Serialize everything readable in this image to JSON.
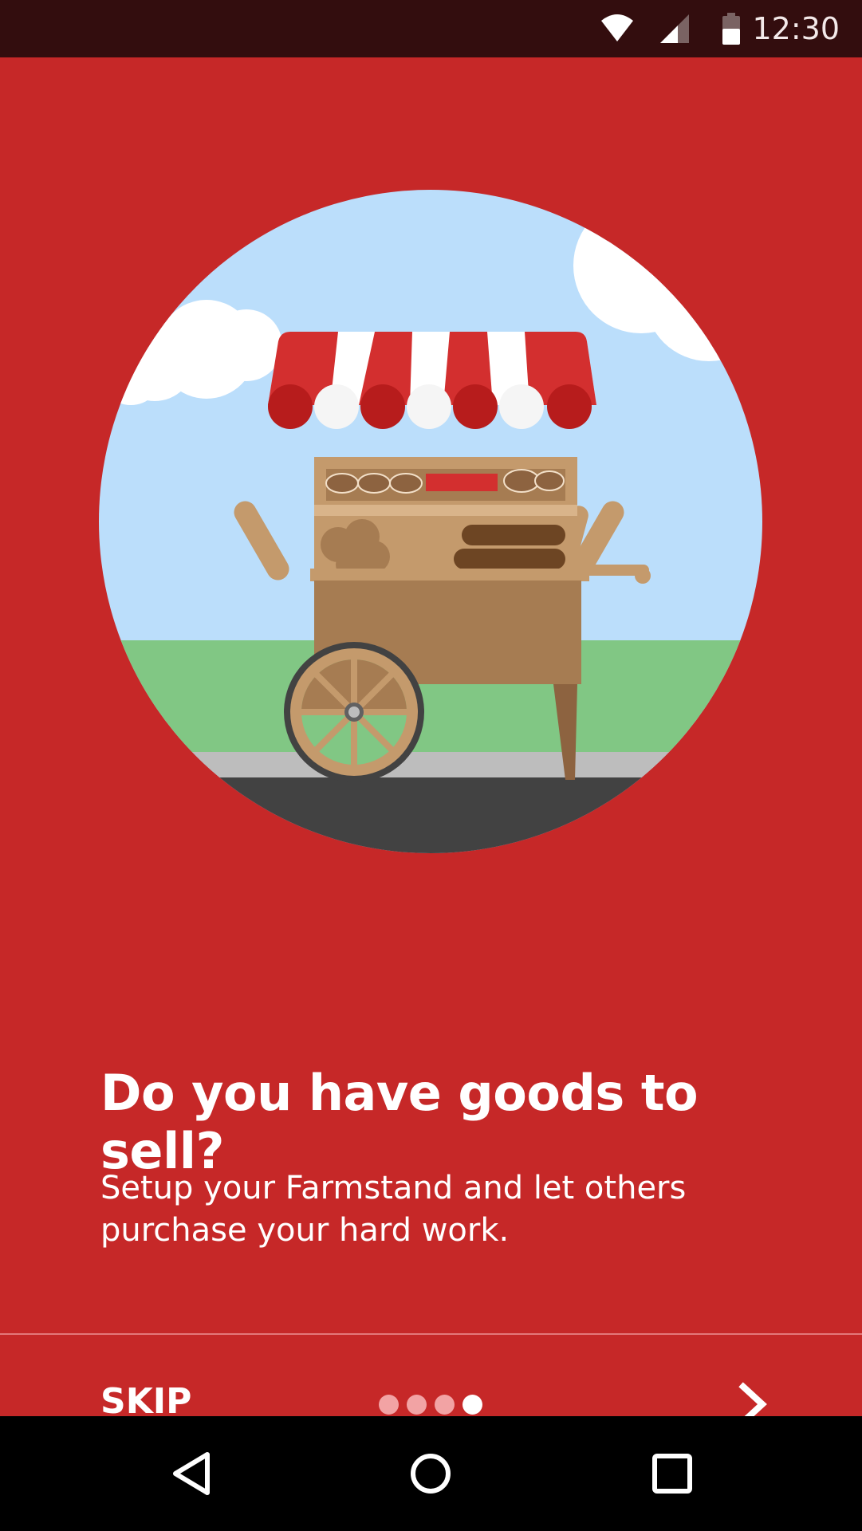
{
  "status_bar": {
    "time": "12:30",
    "icons": [
      "wifi-icon",
      "cell-signal-icon",
      "battery-icon"
    ]
  },
  "illustration": {
    "subject": "farmstand-cart-icon"
  },
  "onboarding": {
    "title": "Do you have goods to sell?",
    "subtitle": "Setup your Farmstand and let others purchase your hard work.",
    "skip_label": "SKIP",
    "page_count": 4,
    "current_page": 4,
    "next_icon": "chevron-right-icon"
  },
  "nav_bar": {
    "buttons": [
      "back-icon",
      "home-icon",
      "recents-icon"
    ]
  },
  "colors": {
    "background": "#c62828",
    "status_bar": "#330d0e",
    "sky": "#bbdefb",
    "grass": "#81c784",
    "road": "#424242",
    "wood": "#a67c52",
    "awning_red": "#d32f2f"
  }
}
